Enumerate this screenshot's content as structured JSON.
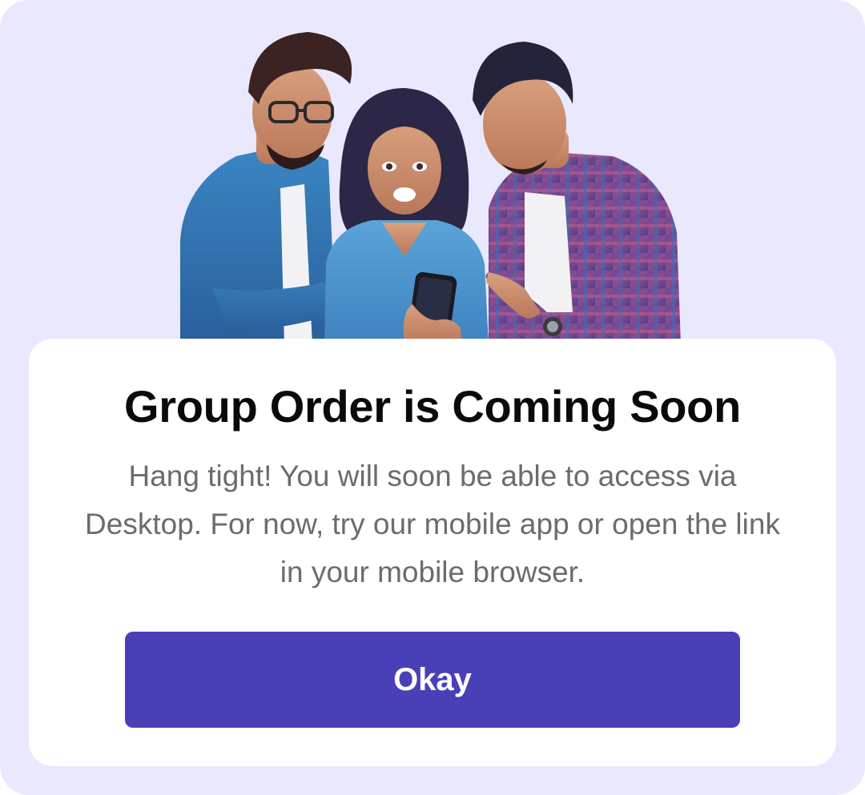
{
  "modal": {
    "title": "Group Order is Coming Soon",
    "description": "Hang tight! You will soon be able to access via Desktop. For now, try our mobile app or open the link in your mobile browser.",
    "okay_label": "Okay"
  },
  "illustration": {
    "icon": "group-friends-with-phone-illustration"
  },
  "colors": {
    "background": "#e9e8fd",
    "card": "#ffffff",
    "title_text": "#0a0a0a",
    "description_text": "#6b6b70",
    "button_background": "#4940b8",
    "button_text": "#ffffff"
  }
}
